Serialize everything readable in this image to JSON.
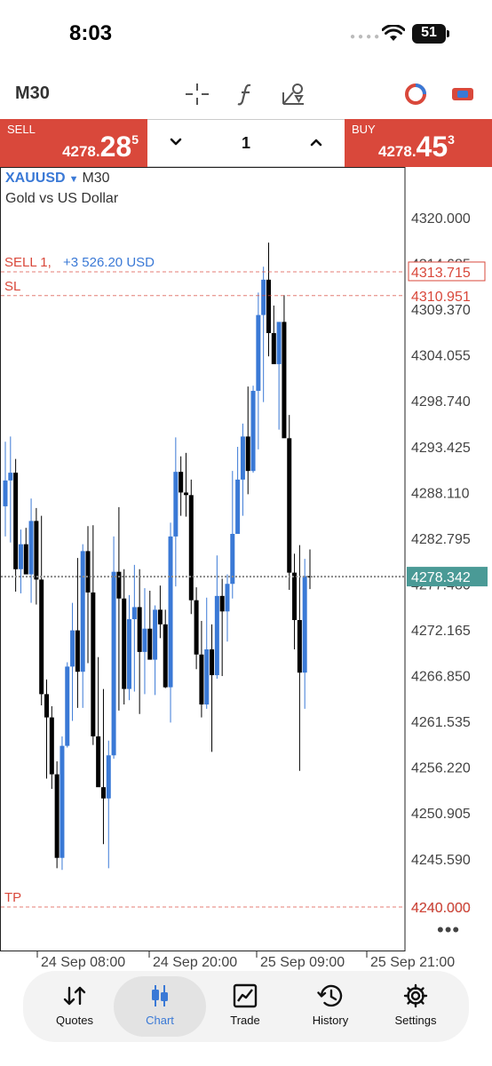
{
  "status": {
    "time": "8:03",
    "battery": "51"
  },
  "toolbar": {
    "timeframe": "M30"
  },
  "trade": {
    "sell_label": "SELL",
    "sell_main": "4278.",
    "sell_big": "28",
    "sell_sup": "5",
    "buy_label": "BUY",
    "buy_main": "4278.",
    "buy_big": "45",
    "buy_sup": "3",
    "quantity": "1"
  },
  "chart_info": {
    "symbol": "XAUUSD",
    "timeframe": "M30",
    "description": "Gold vs US Dollar"
  },
  "colors": {
    "bull": "#3a79d6",
    "bear": "#000000",
    "sell_bg": "#d9483b",
    "level": "#d9483b",
    "current": "#4a9a96",
    "profit": "#3a79d6"
  },
  "chart_data": {
    "type": "candlestick",
    "symbol": "XAUUSD",
    "ylim": [
      4236.0,
      4327.0
    ],
    "y_ticks": [
      "4320.000",
      "4314.685",
      "4309.370",
      "4304.055",
      "4298.740",
      "4293.425",
      "4288.110",
      "4282.795",
      "4277.480",
      "4272.165",
      "4266.850",
      "4261.535",
      "4256.220",
      "4250.905",
      "4245.590",
      "4240.000"
    ],
    "x_ticks": [
      "24 Sep 08:00",
      "24 Sep 20:00",
      "25 Sep 09:00",
      "25 Sep 21:00"
    ],
    "levels": [
      {
        "kind": "position",
        "label": "SELL 1,",
        "profit": "+3 526.20 USD",
        "price": 4313.715,
        "price_label": "4313.715"
      },
      {
        "kind": "sl",
        "label": "SL",
        "price": 4310.951,
        "price_label": "4310.951"
      },
      {
        "kind": "tp",
        "label": "TP",
        "price": 4240.0,
        "price_label": "4240.000"
      }
    ],
    "current": {
      "price": 4278.342,
      "price_label": "4278.342"
    },
    "candles": [
      {
        "o": 4286.5,
        "h": 4294.0,
        "l": 4283.0,
        "c": 4289.5
      },
      {
        "o": 4289.5,
        "h": 4294.6,
        "l": 4282.3,
        "c": 4290.4
      },
      {
        "o": 4290.4,
        "h": 4292.0,
        "l": 4276.6,
        "c": 4279.2
      },
      {
        "o": 4279.2,
        "h": 4283.8,
        "l": 4276.4,
        "c": 4282.1
      },
      {
        "o": 4282.1,
        "h": 4284.0,
        "l": 4279.0,
        "c": 4278.6
      },
      {
        "o": 4278.6,
        "h": 4287.4,
        "l": 4275.3,
        "c": 4284.8
      },
      {
        "o": 4284.8,
        "h": 4286.3,
        "l": 4275.1,
        "c": 4278.0
      },
      {
        "o": 4278.0,
        "h": 4285.4,
        "l": 4263.4,
        "c": 4264.7
      },
      {
        "o": 4264.7,
        "h": 4266.4,
        "l": 4254.9,
        "c": 4262.0
      },
      {
        "o": 4262.0,
        "h": 4263.3,
        "l": 4253.7,
        "c": 4255.4
      },
      {
        "o": 4255.4,
        "h": 4256.9,
        "l": 4244.5,
        "c": 4245.7
      },
      {
        "o": 4245.7,
        "h": 4259.8,
        "l": 4244.3,
        "c": 4258.7
      },
      {
        "o": 4258.7,
        "h": 4268.4,
        "l": 4258.5,
        "c": 4267.9
      },
      {
        "o": 4267.9,
        "h": 4275.3,
        "l": 4261.6,
        "c": 4272.1
      },
      {
        "o": 4272.1,
        "h": 4280.5,
        "l": 4263.1,
        "c": 4267.3
      },
      {
        "o": 4267.3,
        "h": 4282.1,
        "l": 4263.1,
        "c": 4281.3
      },
      {
        "o": 4281.3,
        "h": 4284.2,
        "l": 4268.3,
        "c": 4276.5
      },
      {
        "o": 4276.5,
        "h": 4284.3,
        "l": 4258.8,
        "c": 4259.8
      },
      {
        "o": 4259.8,
        "h": 4269.0,
        "l": 4256.0,
        "c": 4253.9
      },
      {
        "o": 4253.9,
        "h": 4265.3,
        "l": 4247.3,
        "c": 4252.6
      },
      {
        "o": 4252.6,
        "h": 4259.3,
        "l": 4244.5,
        "c": 4257.6
      },
      {
        "o": 4257.6,
        "h": 4283.0,
        "l": 4257.2,
        "c": 4278.9
      },
      {
        "o": 4278.9,
        "h": 4286.4,
        "l": 4262.8,
        "c": 4275.8
      },
      {
        "o": 4275.8,
        "h": 4279.2,
        "l": 4263.5,
        "c": 4265.3
      },
      {
        "o": 4265.3,
        "h": 4276.2,
        "l": 4264.0,
        "c": 4273.4
      },
      {
        "o": 4273.4,
        "h": 4279.7,
        "l": 4265.0,
        "c": 4274.8
      },
      {
        "o": 4274.8,
        "h": 4279.2,
        "l": 4262.4,
        "c": 4269.6
      },
      {
        "o": 4269.6,
        "h": 4277.0,
        "l": 4264.7,
        "c": 4272.3
      },
      {
        "o": 4272.3,
        "h": 4276.7,
        "l": 4269.5,
        "c": 4268.7
      },
      {
        "o": 4268.7,
        "h": 4275.0,
        "l": 4264.6,
        "c": 4274.5
      },
      {
        "o": 4274.5,
        "h": 4277.3,
        "l": 4271.2,
        "c": 4272.8
      },
      {
        "o": 4272.8,
        "h": 4274.5,
        "l": 4265.4,
        "c": 4265.5
      },
      {
        "o": 4265.5,
        "h": 4284.6,
        "l": 4261.4,
        "c": 4283.0
      },
      {
        "o": 4283.0,
        "h": 4294.5,
        "l": 4277.2,
        "c": 4290.5
      },
      {
        "o": 4290.5,
        "h": 4292.3,
        "l": 4285.4,
        "c": 4288.1
      },
      {
        "o": 4288.1,
        "h": 4292.7,
        "l": 4285.3,
        "c": 4287.8
      },
      {
        "o": 4287.8,
        "h": 4289.6,
        "l": 4274.0,
        "c": 4275.6
      },
      {
        "o": 4275.6,
        "h": 4277.1,
        "l": 4267.6,
        "c": 4269.3
      },
      {
        "o": 4269.3,
        "h": 4273.2,
        "l": 4262.0,
        "c": 4263.5
      },
      {
        "o": 4263.5,
        "h": 4275.9,
        "l": 4263.0,
        "c": 4269.9
      },
      {
        "o": 4269.9,
        "h": 4272.8,
        "l": 4258.0,
        "c": 4266.9
      },
      {
        "o": 4266.9,
        "h": 4280.8,
        "l": 4266.5,
        "c": 4276.1
      },
      {
        "o": 4276.1,
        "h": 4278.1,
        "l": 4266.8,
        "c": 4274.3
      },
      {
        "o": 4274.3,
        "h": 4278.6,
        "l": 4270.8,
        "c": 4277.5
      },
      {
        "o": 4277.5,
        "h": 4290.6,
        "l": 4275.8,
        "c": 4283.3
      },
      {
        "o": 4283.3,
        "h": 4293.4,
        "l": 4283.3,
        "c": 4289.6
      },
      {
        "o": 4289.6,
        "h": 4296.1,
        "l": 4285.4,
        "c": 4294.6
      },
      {
        "o": 4294.6,
        "h": 4300.4,
        "l": 4287.9,
        "c": 4290.6
      },
      {
        "o": 4290.6,
        "h": 4300.5,
        "l": 4290.4,
        "c": 4299.9
      },
      {
        "o": 4299.9,
        "h": 4311.3,
        "l": 4293.1,
        "c": 4308.7
      },
      {
        "o": 4308.7,
        "h": 4314.3,
        "l": 4298.6,
        "c": 4312.8
      },
      {
        "o": 4312.8,
        "h": 4317.1,
        "l": 4303.9,
        "c": 4306.6
      },
      {
        "o": 4306.6,
        "h": 4309.8,
        "l": 4303.5,
        "c": 4303.0
      },
      {
        "o": 4303.0,
        "h": 4307.3,
        "l": 4295.4,
        "c": 4307.9
      },
      {
        "o": 4307.9,
        "h": 4311.0,
        "l": 4298.2,
        "c": 4294.4
      },
      {
        "o": 4294.4,
        "h": 4297.1,
        "l": 4276.8,
        "c": 4278.8
      },
      {
        "o": 4278.8,
        "h": 4281.0,
        "l": 4269.9,
        "c": 4273.3
      },
      {
        "o": 4273.3,
        "h": 4282.0,
        "l": 4255.8,
        "c": 4267.2
      },
      {
        "o": 4267.2,
        "h": 4280.4,
        "l": 4263.0,
        "c": 4278.4
      },
      {
        "o": 4278.4,
        "h": 4281.5,
        "l": 4276.9,
        "c": 4278.3
      }
    ]
  },
  "nav": {
    "quotes": "Quotes",
    "chart": "Chart",
    "trade": "Trade",
    "history": "History",
    "settings": "Settings"
  }
}
